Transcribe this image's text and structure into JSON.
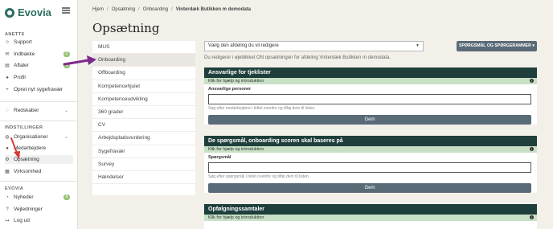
{
  "brand": {
    "name": "Evovia"
  },
  "sidebar": {
    "sections": [
      {
        "heading": "ANETTS"
      },
      {
        "heading": "INDSTILLINGER"
      },
      {
        "heading": "EVOVIA"
      }
    ],
    "items": [
      {
        "label": "Support",
        "icon": "support-icon",
        "glyph": "☺"
      },
      {
        "label": "Indbakke",
        "icon": "inbox-icon",
        "glyph": "✉",
        "badge": "2"
      },
      {
        "label": "Aftaler",
        "icon": "calendar-icon",
        "glyph": "▤",
        "badge": "1"
      },
      {
        "label": "Profil",
        "icon": "user-icon",
        "glyph": "●"
      },
      {
        "label": "Opret nyt sygefravær",
        "icon": "plus-icon",
        "glyph": "+"
      },
      {
        "label": "Redskaber",
        "icon": "tools-icon",
        "glyph": "◌"
      },
      {
        "label": "Organisationer",
        "icon": "organization-icon",
        "glyph": "◍"
      },
      {
        "label": "Medarbejdere",
        "icon": "employees-icon",
        "glyph": "●"
      },
      {
        "label": "Opsætning",
        "icon": "gear-icon",
        "glyph": "⚙"
      },
      {
        "label": "Virksomhed",
        "icon": "building-icon",
        "glyph": "▦"
      },
      {
        "label": "Nyheder",
        "icon": "news-icon",
        "glyph": "◔",
        "badge": "6"
      },
      {
        "label": "Vejledninger",
        "icon": "question-icon",
        "glyph": "?"
      },
      {
        "label": "Log ud",
        "icon": "logout-icon",
        "glyph": "↦"
      }
    ]
  },
  "breadcrumb": [
    "Hjem",
    "Opsætning",
    "Onboarding",
    "Vinterdæk Butikken m demodata"
  ],
  "page_title": "Opsætning",
  "subnav": [
    "MUS",
    "Onboarding",
    "Offboarding",
    "Kompetencehjulet",
    "Kompetenceudvikling",
    "360 grader",
    "CV",
    "Arbejdspladsvurdering",
    "Sygefravær",
    "Survey",
    "Hændelser"
  ],
  "department_select": {
    "value": "Vælg den afdeling du vil redigere"
  },
  "top_button": "SPØRGSMÅL OG SPØRGERAMMER",
  "hint": "Du redigerer i øjeblikket ON opsætningen for afdeling Vinterdæk Butikken m demodata.",
  "cards": [
    {
      "title": "Ansvarlige for tjeklister",
      "help": "Klik for hjælp og introduktion",
      "field_label": "Ansvarlige personer",
      "field_hint": "Søg efter medarbejdere i feltet ovenfor og tilføj dem til listen.",
      "save": "Gem"
    },
    {
      "title": "De spørgsmål, onboarding scoren skal baseres på",
      "help": "Klik for hjælp og introduktion",
      "field_label": "Spørgsmål",
      "field_hint": "Søg efter spørgsmål i feltet ovenfor og tilføj dem til listen.",
      "save": "Gem"
    },
    {
      "title": "Opfølgningssamtaler",
      "help": "Klik for hjælp og introduktion"
    }
  ],
  "colors": {
    "accent": "#2c6e63",
    "card_header": "#1f3f3c",
    "help_bar": "#c8e0c6",
    "button": "#5a6b78",
    "annotation_arrow": "#7b2a8c",
    "annotation_arrow_red": "#d23a3a"
  }
}
